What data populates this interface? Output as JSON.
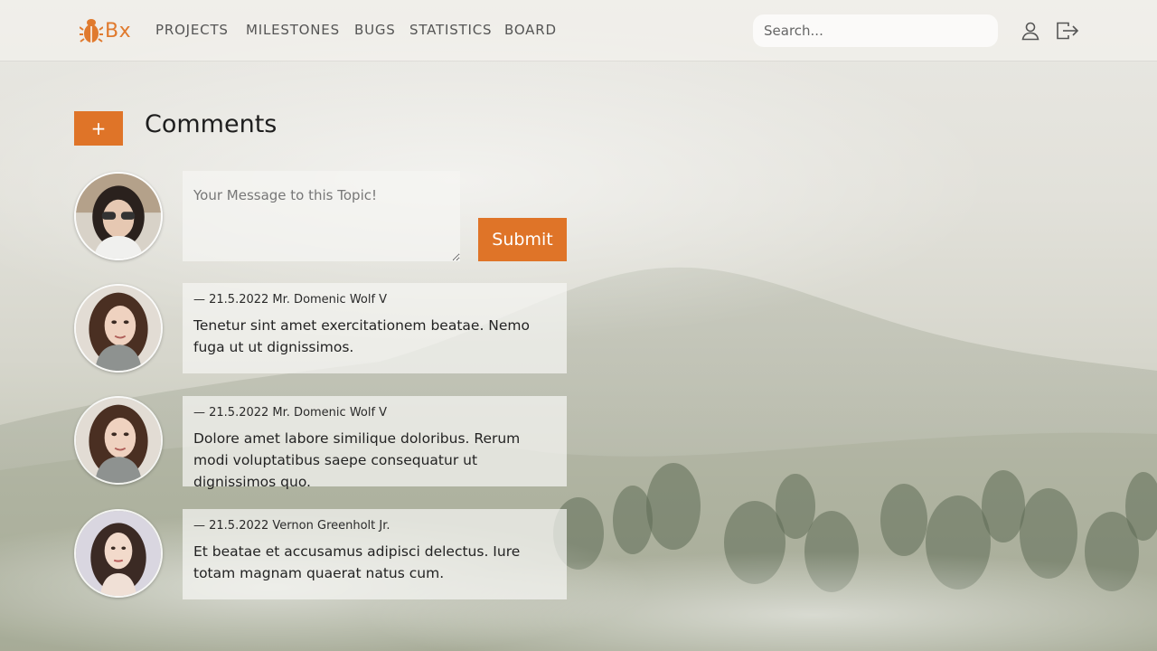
{
  "nav": {
    "logo_text": "Bx",
    "links": [
      {
        "label": "PROJECTS"
      },
      {
        "label": "MILESTONES"
      },
      {
        "label": "BUGS"
      },
      {
        "label": "STATISTICS"
      },
      {
        "label": "BOARD"
      }
    ],
    "search_placeholder": "Search...",
    "icons": [
      "bug-icon",
      "user-icon",
      "logout-icon"
    ]
  },
  "page": {
    "title": "Comments",
    "add_label": "+"
  },
  "composer": {
    "placeholder": "Your Message to this Topic!",
    "submit_label": "Submit"
  },
  "comments": [
    {
      "meta": "— 21.5.2022 Mr. Domenic Wolf V",
      "text": "Tenetur sint amet exercitationem beatae. Nemo fuga ut ut dignissimos."
    },
    {
      "meta": "— 21.5.2022 Mr. Domenic Wolf V",
      "text": "Dolore amet labore similique doloribus. Rerum modi voluptatibus saepe consequatur ut dignissimos quo."
    },
    {
      "meta": "— 21.5.2022 Vernon Greenholt Jr.",
      "text": "Et beatae et accusamus adipisci delectus. Iure totam magnam quaerat natus cum."
    }
  ],
  "colors": {
    "accent": "#df7428",
    "nav_text": "#555555"
  }
}
